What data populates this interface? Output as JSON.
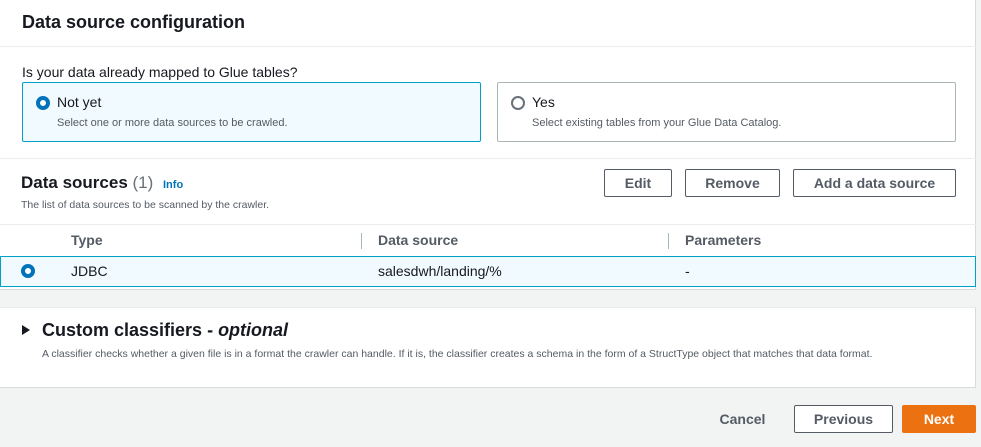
{
  "section": {
    "title": "Data source configuration",
    "question": "Is your data already mapped to Glue tables?",
    "options": [
      {
        "label": "Not yet",
        "description": "Select one or more data sources to be crawled.",
        "selected": true
      },
      {
        "label": "Yes",
        "description": "Select existing tables from your Glue Data Catalog.",
        "selected": false
      }
    ]
  },
  "data_sources": {
    "title": "Data sources",
    "count": "(1)",
    "info": "Info",
    "description": "The list of data sources to be scanned by the crawler.",
    "buttons": {
      "edit": "Edit",
      "remove": "Remove",
      "add": "Add a data source"
    },
    "columns": [
      "Type",
      "Data source",
      "Parameters"
    ],
    "rows": [
      {
        "type": "JDBC",
        "source": "salesdwh/landing/%",
        "parameters": "-",
        "selected": true
      }
    ]
  },
  "custom_classifiers": {
    "title": "Custom classifiers - ",
    "optional": "optional",
    "description": "A classifier checks whether a given file is in a format the crawler can handle. If it is, the classifier creates a schema in the form of a StructType object that matches that data format."
  },
  "footer": {
    "cancel": "Cancel",
    "previous": "Previous",
    "next": "Next"
  },
  "colors": {
    "accent": "#0073bb",
    "primary_button": "#ec7211",
    "selected_bg": "#f1faff"
  }
}
